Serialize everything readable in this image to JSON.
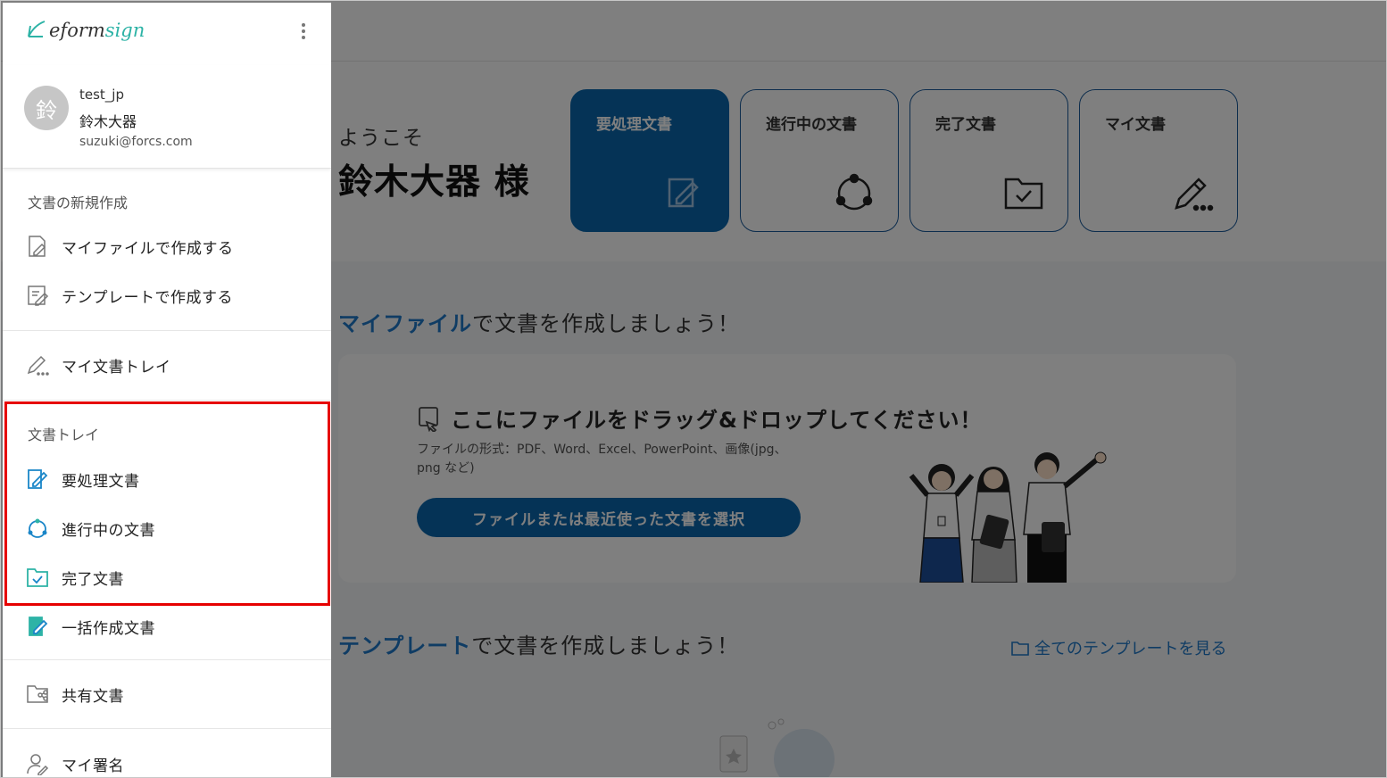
{
  "main": {
    "welcome": {
      "hello": "ようこそ",
      "name": "鈴木大器 様"
    },
    "tiles": [
      {
        "label": "要処理文書",
        "icon": "edit-document-icon",
        "active": true
      },
      {
        "label": "進行中の文書",
        "icon": "progress-cycle-icon",
        "active": false
      },
      {
        "label": "完了文書",
        "icon": "folder-check-icon",
        "active": false
      },
      {
        "label": "マイ文書",
        "icon": "pencil-dots-icon",
        "active": false
      }
    ],
    "myfile_section": {
      "highlight": "マイファイル",
      "rest": "で文書を作成しましょう！"
    },
    "dropzone": {
      "title": "ここにファイルをドラッグ&ドロップしてください！",
      "formats": "ファイルの形式：PDF、Word、Excel、PowerPoint、画像(jpg、png など)",
      "button": "ファイルまたは最近使った文書を選択"
    },
    "template_section": {
      "highlight": "テンプレート",
      "rest": "で文書を作成しましょう！"
    },
    "all_templates_link": "全てのテンプレートを見る"
  },
  "sidebar": {
    "logo": {
      "prefix": "eform",
      "suffix": "sign"
    },
    "profile": {
      "avatar_char": "鈴",
      "id": "test_jp",
      "name": "鈴木大器",
      "email": "suzuki@forcs.com"
    },
    "new_doc": {
      "title": "文書の新規作成",
      "items": [
        {
          "label": "マイファイルで作成する",
          "icon": "file-edit-icon"
        },
        {
          "label": "テンプレートで作成する",
          "icon": "template-edit-icon"
        }
      ]
    },
    "my_tray": {
      "label": "マイ文書トレイ",
      "icon": "pencil-dots-icon"
    },
    "doc_tray": {
      "title": "文書トレイ",
      "items": [
        {
          "label": "要処理文書",
          "icon": "edit-document-icon"
        },
        {
          "label": "進行中の文書",
          "icon": "progress-cycle-icon"
        },
        {
          "label": "完了文書",
          "icon": "folder-check-icon"
        },
        {
          "label": "一括作成文書",
          "icon": "bulk-document-icon"
        }
      ]
    },
    "shared": {
      "label": "共有文書",
      "icon": "shared-folder-icon"
    },
    "signature": {
      "label": "マイ署名",
      "icon": "signature-user-icon"
    }
  },
  "colors": {
    "accent": "#0a67ad",
    "link": "#1f78c8",
    "highlight_box": "#e60000",
    "brand_green": "#2db3a6"
  }
}
